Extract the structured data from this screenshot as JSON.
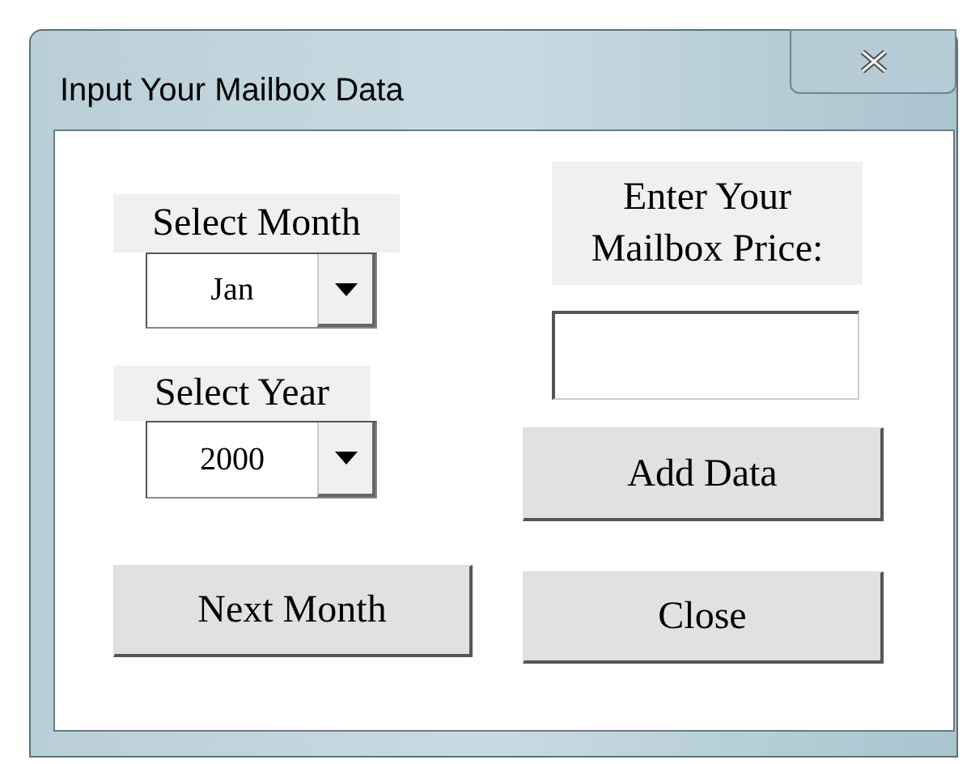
{
  "window": {
    "title": "Input Your Mailbox Data"
  },
  "month": {
    "label": "Select Month",
    "value": "Jan"
  },
  "year": {
    "label": "Select Year",
    "value": "2000"
  },
  "price": {
    "label_lines": [
      "Enter Your",
      "Mailbox Price:"
    ]
  },
  "buttons": {
    "add": "Add Data",
    "next": "Next Month",
    "close": "Close"
  }
}
